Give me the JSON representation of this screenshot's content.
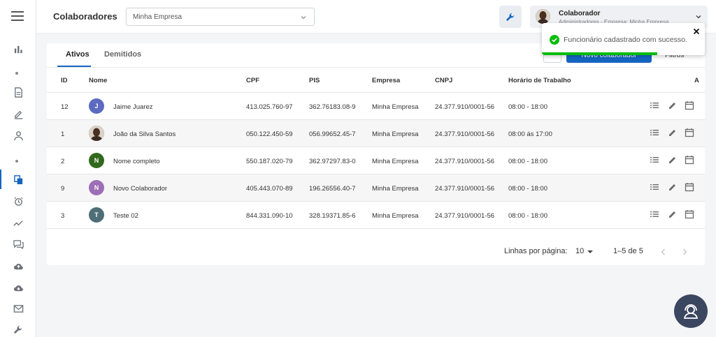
{
  "header": {
    "title": "Colaboradores",
    "company_select_value": "Minha Empresa",
    "user": {
      "name": "Colaborador",
      "role": "Administradores - Empresa: Minha Empresa"
    }
  },
  "tabs": [
    {
      "label": "Ativos",
      "active": true
    },
    {
      "label": "Demitidos",
      "active": false
    }
  ],
  "toolbar": {
    "new_button_label": "Novo colaborador",
    "filter_label": "Filtros"
  },
  "table": {
    "columns": [
      "ID",
      "Nome",
      "CPF",
      "PIS",
      "Empresa",
      "CNPJ",
      "Horário de Trabalho",
      "A"
    ],
    "rows": [
      {
        "id": "12",
        "initial": "J",
        "avatar_color": "#5c6bc0",
        "name": "Jaime Juarez",
        "cpf": "413.025.760-97",
        "pis": "362.76183.08-9",
        "empresa": "Minha Empresa",
        "cnpj": "24.377.910/0001-56",
        "horario": "08:00 - 18:00",
        "photo": false
      },
      {
        "id": "1",
        "initial": "",
        "avatar_color": "#5a3a26",
        "name": "João da Silva Santos",
        "cpf": "050.122.450-59",
        "pis": "056.99652.45-7",
        "empresa": "Minha Empresa",
        "cnpj": "24.377.910/0001-56",
        "horario": "08:00 ás 17:00",
        "photo": true
      },
      {
        "id": "2",
        "initial": "N",
        "avatar_color": "#33691e",
        "name": "Nome completo",
        "cpf": "550.187.020-79",
        "pis": "362.97297.83-0",
        "empresa": "Minha Empresa",
        "cnpj": "24.377.910/0001-56",
        "horario": "08:00 - 18:00",
        "photo": false
      },
      {
        "id": "9",
        "initial": "N",
        "avatar_color": "#9c6fb6",
        "name": "Novo Colaborador",
        "cpf": "405.443.070-89",
        "pis": "196.26556.40-7",
        "empresa": "Minha Empresa",
        "cnpj": "24.377.910/0001-56",
        "horario": "08:00 - 18:00",
        "photo": false
      },
      {
        "id": "3",
        "initial": "T",
        "avatar_color": "#4e6e78",
        "name": "Teste 02",
        "cpf": "844.331.090-10",
        "pis": "328.19371.85-6",
        "empresa": "Minha Empresa",
        "cnpj": "24.377.910/0001-56",
        "horario": "08:00 - 18:00",
        "photo": false
      }
    ]
  },
  "pagination": {
    "rows_per_page_label": "Linhas por página:",
    "rows_per_page_value": "10",
    "range_label": "1–5 de 5"
  },
  "toast": {
    "message": "Funcionário cadastrado com sucesso.",
    "progress": 0.71
  },
  "sidebar": {
    "icons": [
      "menu-icon",
      "bar-chart-icon",
      "document-icon",
      "edit-icon",
      "person-icon",
      "copy-icon",
      "alarm-icon",
      "trend-icon",
      "chat-icon",
      "cloud-upload-icon",
      "cloud-download-icon",
      "mail-icon",
      "wrench-icon"
    ],
    "active": "copy-icon"
  },
  "colors": {
    "primary": "#1565c0",
    "success": "#07bc0c",
    "help_button": "#3b4660"
  }
}
